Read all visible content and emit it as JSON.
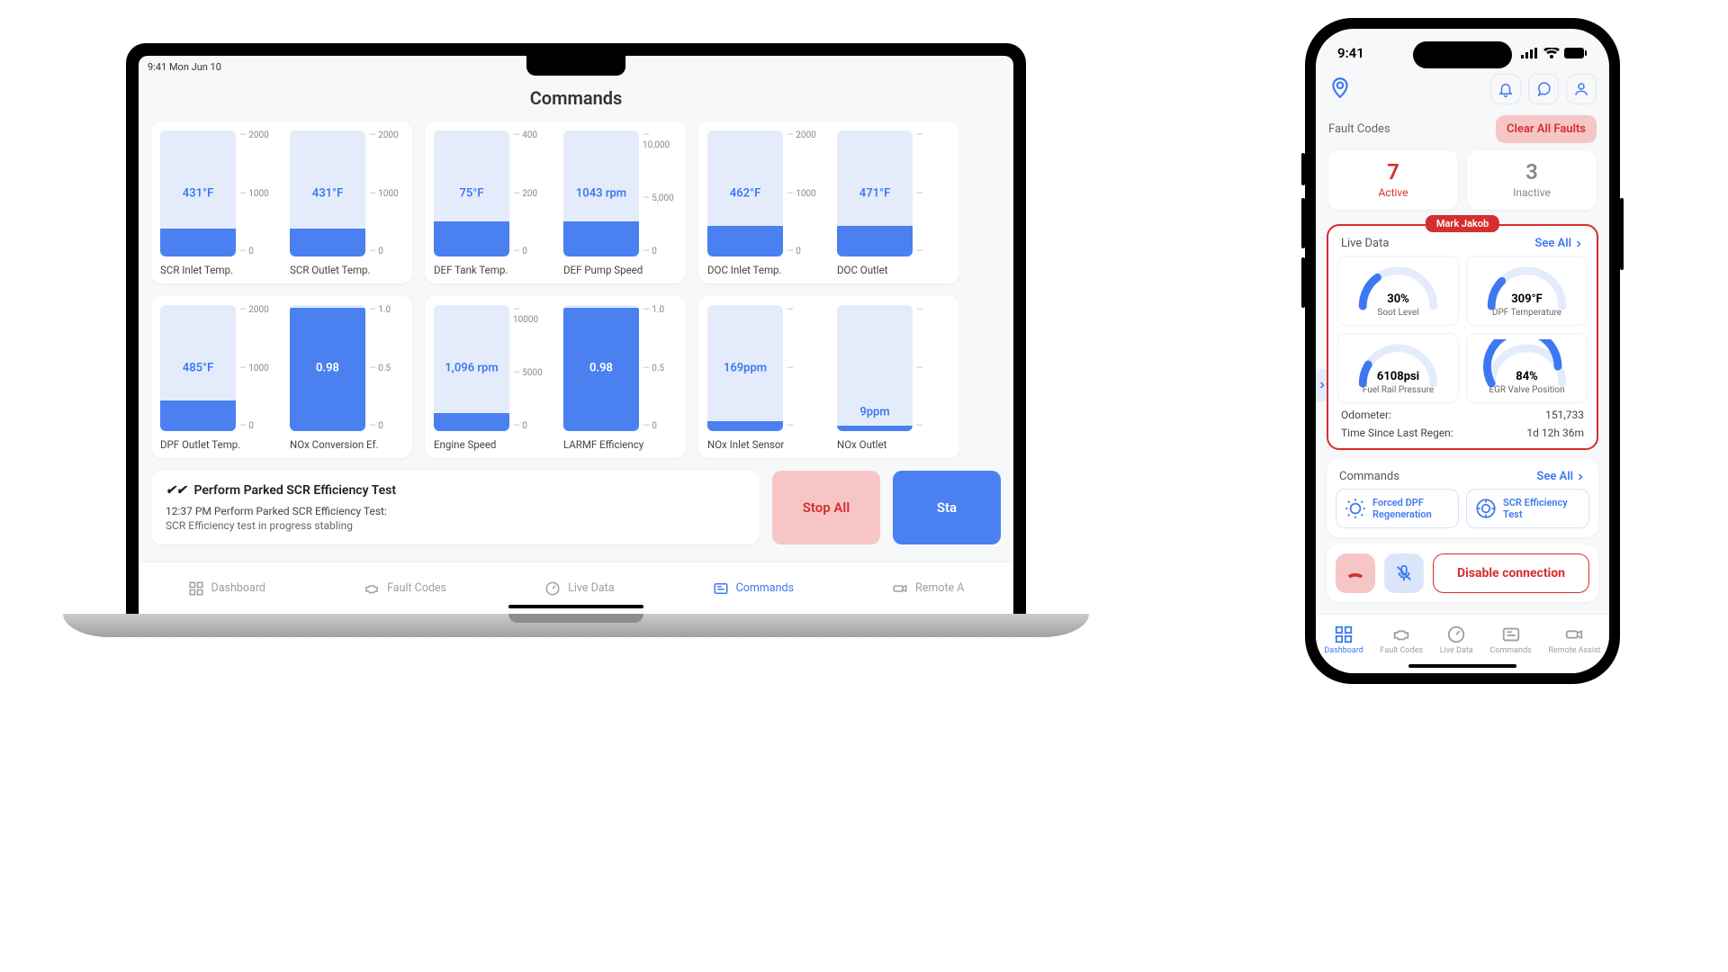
{
  "laptop": {
    "menubar": "9:41  Mon Jun 10",
    "page_title": "Commands",
    "gauges_row1": [
      {
        "label": "SCR Inlet Temp.",
        "value": "431°F",
        "fill_pct": 22,
        "val_pos": 50,
        "val_color": "blue",
        "ticks": [
          "2000",
          "1000",
          "0"
        ]
      },
      {
        "label": "SCR Outlet Temp.",
        "value": "431°F",
        "fill_pct": 22,
        "val_pos": 50,
        "val_color": "blue",
        "ticks": [
          "2000",
          "1000",
          "0"
        ]
      },
      {
        "label": "DEF Tank Temp.",
        "value": "75°F",
        "fill_pct": 28,
        "val_pos": 50,
        "val_color": "blue",
        "ticks": [
          "400",
          "200",
          "0"
        ]
      },
      {
        "label": "DEF Pump Speed",
        "value": "1043 rpm",
        "fill_pct": 28,
        "val_pos": 50,
        "val_color": "blue",
        "ticks": [
          "10,000",
          "5,000",
          "0"
        ]
      },
      {
        "label": "DOC Inlet Temp.",
        "value": "462°F",
        "fill_pct": 24,
        "val_pos": 50,
        "val_color": "blue",
        "ticks": [
          "2000",
          "1000",
          "0"
        ]
      },
      {
        "label": "DOC Outlet",
        "value": "471°F",
        "fill_pct": 24,
        "val_pos": 50,
        "val_color": "blue",
        "ticks": [
          "",
          "",
          ""
        ]
      }
    ],
    "gauges_row2": [
      {
        "label": "DPF Outlet Temp.",
        "value": "485°F",
        "fill_pct": 24,
        "val_pos": 50,
        "val_color": "blue",
        "ticks": [
          "2000",
          "1000",
          "0"
        ]
      },
      {
        "label": "NOx Conversion Ef.",
        "value": "0.98",
        "fill_pct": 98,
        "val_pos": 50,
        "val_color": "white",
        "ticks": [
          "1.0",
          "0.5",
          "0"
        ]
      },
      {
        "label": "Engine Speed",
        "value": "1,096 rpm",
        "fill_pct": 14,
        "val_pos": 50,
        "val_color": "blue",
        "ticks": [
          "10000",
          "5000",
          "0"
        ]
      },
      {
        "label": "LARMF Efficiency",
        "value": "0.98",
        "fill_pct": 98,
        "val_pos": 50,
        "val_color": "white",
        "ticks": [
          "1.0",
          "0.5",
          "0"
        ]
      },
      {
        "label": "NOx Inlet Sensor",
        "value": "169ppm",
        "fill_pct": 8,
        "val_pos": 50,
        "val_color": "blue",
        "ticks": [
          "",
          "",
          ""
        ]
      },
      {
        "label": "NOx Outlet",
        "value": "9ppm",
        "fill_pct": 4,
        "val_pos": 85,
        "val_color": "blue",
        "ticks": [
          "",
          "",
          ""
        ]
      }
    ],
    "test_title": "Perform Parked SCR Efficiency Test",
    "test_line1": "12:37 PM Perform Parked SCR Efficiency Test:",
    "test_line2": "SCR Efficiency test in progress stabling",
    "stop_all": "Stop All",
    "start": "Sta",
    "tabs": {
      "dashboard": "Dashboard",
      "fault_codes": "Fault Codes",
      "live_data": "Live Data",
      "commands": "Commands",
      "remote": "Remote A"
    }
  },
  "phone": {
    "time": "9:41",
    "fault_codes_label": "Fault Codes",
    "clear_all": "Clear All Faults",
    "active_count": "7",
    "active_label": "Active",
    "inactive_count": "3",
    "inactive_label": "Inactive",
    "chip": "Mark Jakob",
    "live_data_label": "Live Data",
    "see_all": "See All",
    "dials": [
      {
        "value": "30%",
        "label": "Soot Level",
        "pct": 30
      },
      {
        "value": "309°F",
        "label": "DPF Temperature",
        "pct": 25
      },
      {
        "value": "6108psi",
        "label": "Fuel Rail Pressure",
        "pct": 18
      },
      {
        "value": "84%",
        "label": "EGR Valve Position",
        "pct": 84
      }
    ],
    "odo_label": "Odometer:",
    "odo_value": "151,733",
    "regen_label": "Time Since Last Regen:",
    "regen_value": "1d 12h 36m",
    "commands_label": "Commands",
    "cmd1": "Forced DPF Regeneration",
    "cmd2": "SCR Efficiency Test",
    "disable": "Disable connection",
    "tabs": {
      "dashboard": "Dashboard",
      "fault_codes": "Fault Codes",
      "live_data": "Live Data",
      "commands": "Commands",
      "remote": "Remote Assist"
    }
  }
}
